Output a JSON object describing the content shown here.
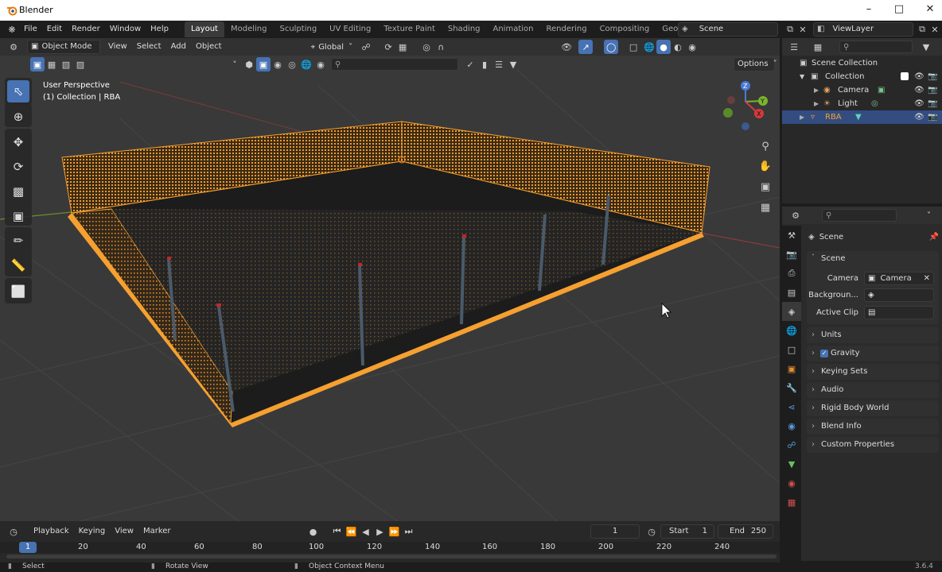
{
  "window": {
    "title": "Blender"
  },
  "menu": [
    "File",
    "Edit",
    "Render",
    "Window",
    "Help"
  ],
  "workspaces": [
    "Layout",
    "Modeling",
    "Sculpting",
    "UV Editing",
    "Texture Paint",
    "Shading",
    "Animation",
    "Rendering",
    "Compositing",
    "Geometry Nodes"
  ],
  "active_workspace": "Layout",
  "scene_field": "Scene",
  "viewlayer_field": "ViewLayer",
  "viewport": {
    "mode": "Object Mode",
    "menus": [
      "View",
      "Select",
      "Add",
      "Object"
    ],
    "orientation": "Global",
    "options_label": "Options",
    "overlay_text_1": "User Perspective",
    "overlay_text_2": "(1) Collection | RBA",
    "axis_labels": [
      "Z",
      "Y",
      "X"
    ]
  },
  "outliner": {
    "items": [
      {
        "label": "Scene Collection",
        "icon": "collection-icon"
      },
      {
        "label": "Collection",
        "icon": "collection-icon"
      },
      {
        "label": "Camera",
        "icon": "camera-icon"
      },
      {
        "label": "Light",
        "icon": "light-icon"
      },
      {
        "label": "RBA",
        "icon": "mesh-icon"
      }
    ]
  },
  "properties": {
    "header": "Scene",
    "section": "Scene",
    "camera_label": "Camera",
    "camera_value": "Camera",
    "background_label": "Backgroun...",
    "active_clip_label": "Active Clip",
    "panels": [
      "Units",
      "Gravity",
      "Keying Sets",
      "Audio",
      "Rigid Body World",
      "Blend Info",
      "Custom Properties"
    ]
  },
  "timeline": {
    "menus": [
      "Playback",
      "Keying",
      "View",
      "Marker"
    ],
    "current_frame": "1",
    "start_label": "Start",
    "start_value": "1",
    "end_label": "End",
    "end_value": "250",
    "ruler": [
      "1",
      "20",
      "40",
      "60",
      "80",
      "100",
      "120",
      "140",
      "160",
      "180",
      "200",
      "220",
      "240"
    ]
  },
  "statusbar": {
    "left": "Select",
    "middle": "Rotate View",
    "right": "Object Context Menu",
    "version": "3.6.4"
  },
  "colors": {
    "accent": "#4772b3",
    "selection": "#f5a030",
    "bg": "#393939"
  }
}
